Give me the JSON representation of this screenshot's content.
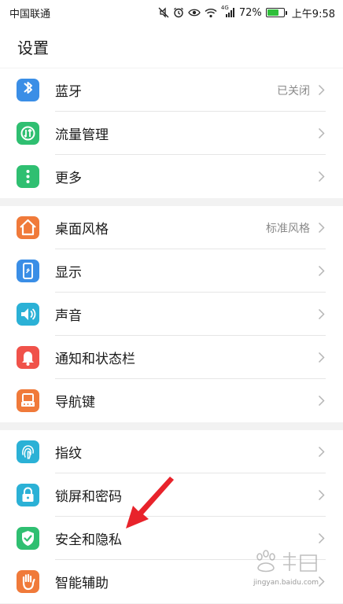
{
  "statusbar": {
    "carrier": "中国联通",
    "network": "4G",
    "battery": "72%",
    "battery_level": 0.72,
    "time": "上午9:58"
  },
  "header": {
    "title": "设置"
  },
  "groups": [
    [
      {
        "label": "蓝牙",
        "value": "已关闭",
        "icon": "bluetooth-icon",
        "color": "#3a8ee6"
      },
      {
        "label": "流量管理",
        "value": "",
        "icon": "data-usage-icon",
        "color": "#2fbf71"
      },
      {
        "label": "更多",
        "value": "",
        "icon": "more-icon",
        "color": "#2fbf71"
      }
    ],
    [
      {
        "label": "桌面风格",
        "value": "标准风格",
        "icon": "home-icon",
        "color": "#f07a3a"
      },
      {
        "label": "显示",
        "value": "",
        "icon": "display-icon",
        "color": "#3a8ee6"
      },
      {
        "label": "声音",
        "value": "",
        "icon": "speaker-icon",
        "color": "#2bb1d6"
      },
      {
        "label": "通知和状态栏",
        "value": "",
        "icon": "bell-icon",
        "color": "#f0524a"
      },
      {
        "label": "导航键",
        "value": "",
        "icon": "navigation-key-icon",
        "color": "#f07a3a"
      }
    ],
    [
      {
        "label": "指纹",
        "value": "",
        "icon": "fingerprint-icon",
        "color": "#2bb1d6"
      },
      {
        "label": "锁屏和密码",
        "value": "",
        "icon": "lock-icon",
        "color": "#2bb1d6"
      },
      {
        "label": "安全和隐私",
        "value": "",
        "icon": "shield-check-icon",
        "color": "#2fbf71"
      },
      {
        "label": "智能辅助",
        "value": "",
        "icon": "hand-icon",
        "color": "#f07a3a"
      }
    ]
  ],
  "watermark": {
    "text": "jingyan.baidu.com"
  },
  "colors": {
    "annotation_arrow": "#e8232b"
  }
}
